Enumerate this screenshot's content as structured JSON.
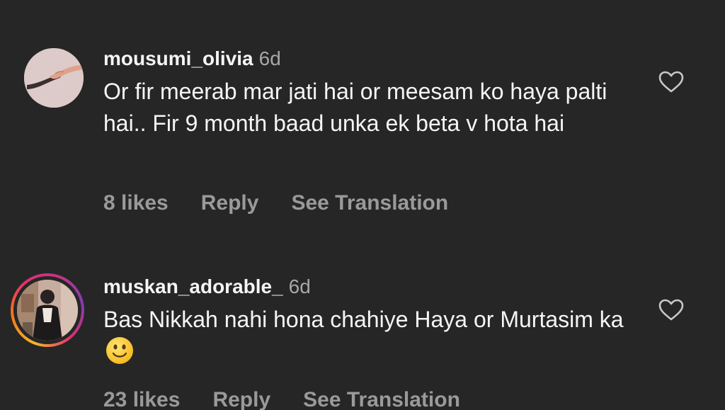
{
  "comments": [
    {
      "username": "mousumi_olivia",
      "time": "6d",
      "text": "Or fir meerab mar jati hai or meesam ko haya palti hai.. Fir 9 month baad unka ek beta v hota hai",
      "likes": "8 likes",
      "reply_label": "Reply",
      "translate_label": "See Translation",
      "avatar": "hand-holding-avatar",
      "has_story_ring": false
    },
    {
      "username": "muskan_adorable_",
      "time": "6d",
      "text": "Bas Nikkah nahi hona chahiye Haya or Murtasim ka",
      "emoji": "slightly-smiling-face-emoji",
      "likes": "23 likes",
      "reply_label": "Reply",
      "translate_label": "See Translation",
      "avatar": "person-photo-avatar",
      "has_story_ring": true
    }
  ],
  "colors": {
    "background": "#262626",
    "primary_text": "#f5f5f5",
    "secondary_text": "#a8a8a8",
    "story_ring": [
      "#f7b52e",
      "#e1306c",
      "#833ab4"
    ]
  }
}
